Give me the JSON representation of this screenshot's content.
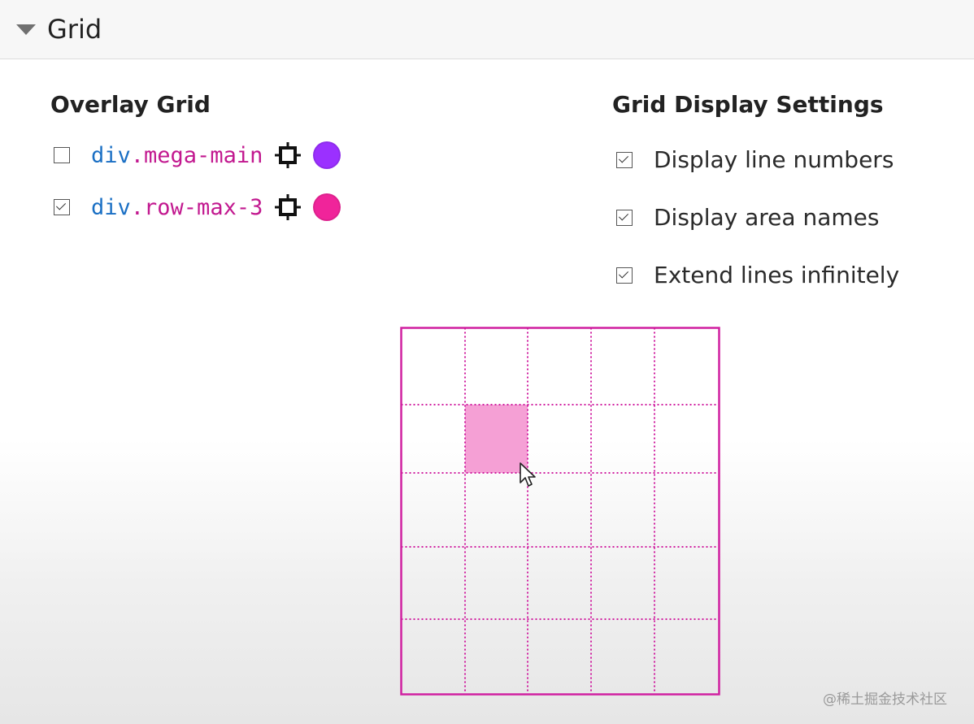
{
  "header": {
    "title": "Grid",
    "expanded": true
  },
  "overlay_grid": {
    "title": "Overlay Grid",
    "items": [
      {
        "tag": "div",
        "class": ".mega-main",
        "checked": false,
        "color": "#9b30ff"
      },
      {
        "tag": "div",
        "class": ".row-max-3",
        "checked": true,
        "color": "#f0249a"
      }
    ]
  },
  "display_settings": {
    "title": "Grid Display Settings",
    "options": [
      {
        "label": "Display line numbers",
        "checked": true
      },
      {
        "label": "Display area names",
        "checked": true
      },
      {
        "label": "Extend lines infinitely",
        "checked": true
      }
    ]
  },
  "preview": {
    "line_color": "#d020a0",
    "highlight_color": "#f5a0d5",
    "columns": 5,
    "rows": 5,
    "highlighted_cell": {
      "row": 2,
      "column": 2
    }
  },
  "watermark": "@稀土掘金技术社区"
}
